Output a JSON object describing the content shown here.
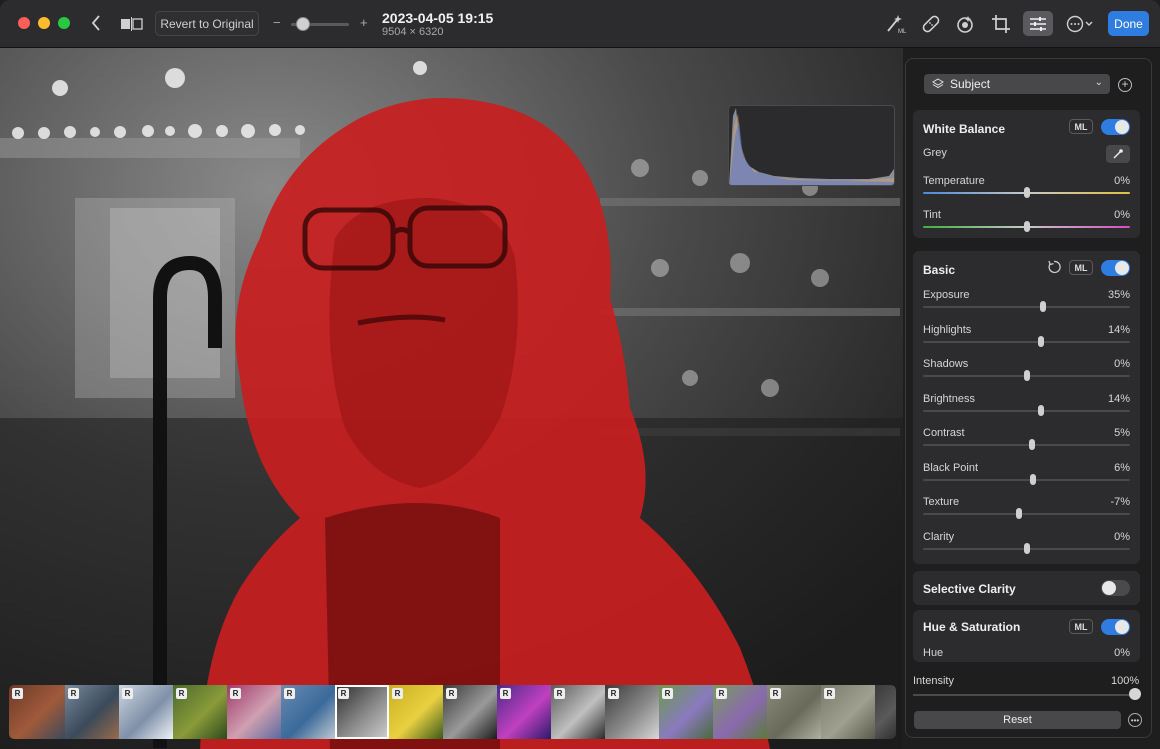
{
  "toolbar": {
    "revert_label": "Revert to Original",
    "zoom_minus": "−",
    "zoom_plus": "+",
    "zoom_level": 0.2,
    "title": "2023-04-05 19:15",
    "dimensions": "9504 × 6320",
    "done_label": "Done",
    "icons": [
      "back-chevron-icon",
      "compare-split-icon",
      "magic-wand-ml-icon",
      "bandage-retouch-icon",
      "red-eye-icon",
      "crop-icon",
      "adjust-sliders-icon",
      "more-options-icon"
    ]
  },
  "mask_selector": {
    "value": "Subject"
  },
  "white_balance": {
    "title": "White Balance",
    "ml_label": "ML",
    "enabled": true,
    "grey_label": "Grey",
    "sliders": [
      {
        "label": "Temperature",
        "value": "0%",
        "pos": 0.5
      },
      {
        "label": "Tint",
        "value": "0%",
        "pos": 0.5
      }
    ]
  },
  "basic": {
    "title": "Basic",
    "ml_label": "ML",
    "enabled": true,
    "sliders": [
      {
        "label": "Exposure",
        "value": "35%",
        "pos": 0.58
      },
      {
        "label": "Highlights",
        "value": "14%",
        "pos": 0.57
      },
      {
        "label": "Shadows",
        "value": "0%",
        "pos": 0.5
      },
      {
        "label": "Brightness",
        "value": "14%",
        "pos": 0.57
      },
      {
        "label": "Contrast",
        "value": "5%",
        "pos": 0.525
      },
      {
        "label": "Black Point",
        "value": "6%",
        "pos": 0.53
      },
      {
        "label": "Texture",
        "value": "-7%",
        "pos": 0.465
      },
      {
        "label": "Clarity",
        "value": "0%",
        "pos": 0.5
      }
    ]
  },
  "selective_clarity": {
    "title": "Selective Clarity",
    "enabled": false
  },
  "hue_saturation": {
    "title": "Hue & Saturation",
    "ml_label": "ML",
    "enabled": true,
    "hue_label": "Hue",
    "hue_value": "0%"
  },
  "intensity": {
    "label": "Intensity",
    "value": "100%",
    "pos": 1.0
  },
  "reset_label": "Reset",
  "filmstrip": [
    {
      "badge": "R",
      "colors": [
        "#6b3a2a",
        "#a05a3a",
        "#3d4a5a"
      ]
    },
    {
      "badge": "R",
      "colors": [
        "#7a8aa0",
        "#3a4a5a",
        "#9a6a4a"
      ]
    },
    {
      "badge": "R",
      "colors": [
        "#cfd6e0",
        "#8090a8",
        "#eef2f8"
      ]
    },
    {
      "badge": "R",
      "colors": [
        "#4a6a2a",
        "#8a9a3a",
        "#2a4a1a"
      ]
    },
    {
      "badge": "R",
      "colors": [
        "#a03a6a",
        "#d0a0b0",
        "#5a6aa0"
      ]
    },
    {
      "badge": "R",
      "colors": [
        "#6a8ab0",
        "#3a6a9a",
        "#c0c8d0"
      ]
    },
    {
      "badge": "R",
      "colors": [
        "#2a2a2a",
        "#8a8a8a",
        "#d0d0d0"
      ]
    },
    {
      "badge": "R",
      "colors": [
        "#c8b020",
        "#e8d040",
        "#3a5a1a"
      ]
    },
    {
      "badge": "R",
      "colors": [
        "#3a3a3a",
        "#9a9a9a",
        "#1a1a1a"
      ]
    },
    {
      "badge": "R",
      "colors": [
        "#4a2a8a",
        "#c040c0",
        "#2a1a6a"
      ]
    },
    {
      "badge": "R",
      "colors": [
        "#5a5a5a",
        "#c0c0c0",
        "#2a2a2a"
      ]
    },
    {
      "badge": "R",
      "colors": [
        "#3a3a3a",
        "#8a8a8a",
        "#d8d8d8"
      ]
    },
    {
      "badge": "R",
      "colors": [
        "#6a9a4a",
        "#8a7ac0",
        "#4a6a3a"
      ]
    },
    {
      "badge": "R",
      "colors": [
        "#7a9a5a",
        "#8a6ab0",
        "#5a7a3a"
      ]
    },
    {
      "badge": "R",
      "colors": [
        "#8a8a7a",
        "#6a6a5a",
        "#b0b0a0"
      ]
    },
    {
      "badge": "R",
      "colors": [
        "#7a7a6a",
        "#a0a090",
        "#5a5a4a"
      ]
    },
    {
      "badge": "",
      "colors": [
        "#3a3a3a",
        "#5a5a5a",
        "#2a2a2a"
      ]
    }
  ],
  "accent_color": "#2f7de1",
  "mask_color": "#c81e1e"
}
